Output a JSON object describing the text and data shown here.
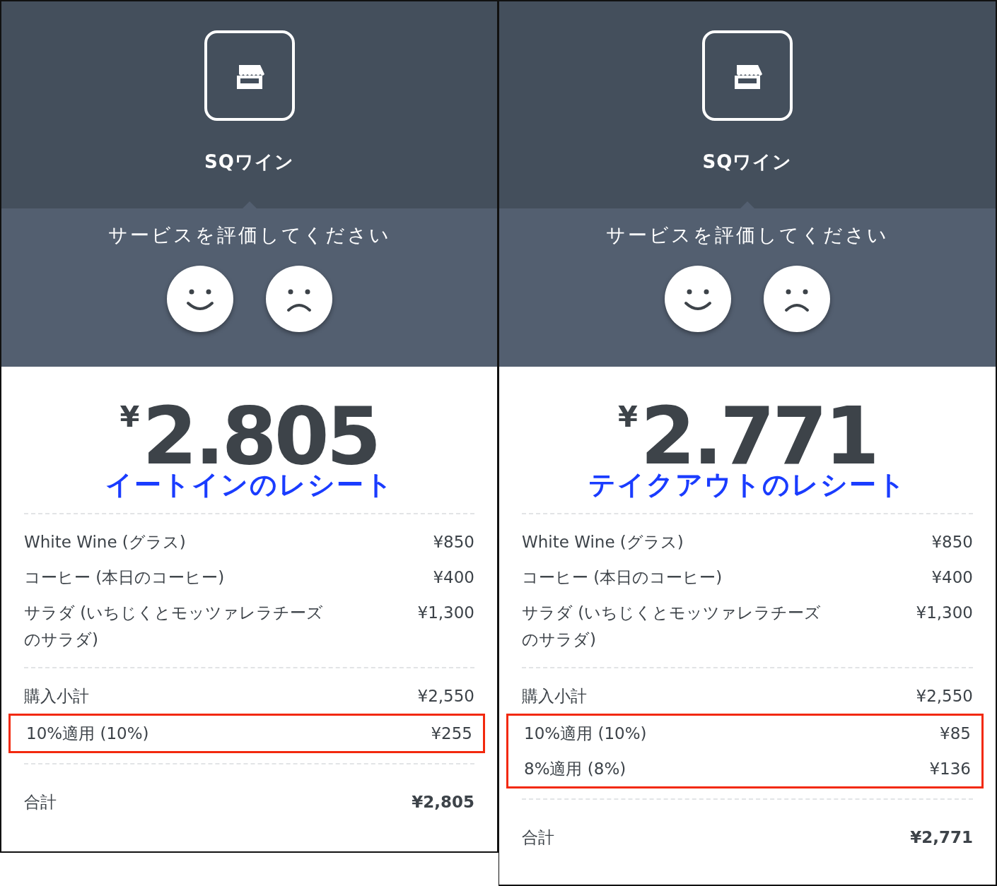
{
  "receipts": [
    {
      "store_name": "SQワイン",
      "rating_prompt": "サービスを評価してください",
      "currency": "¥",
      "amount": "2.805",
      "caption": "イートインのレシート",
      "items": [
        {
          "name": "White Wine (グラス)",
          "price": "¥850"
        },
        {
          "name": "コーヒー (本日のコーヒー)",
          "price": "¥400"
        },
        {
          "name": "サラダ (いちじくとモッツァレラチーズのサラダ)",
          "price": "¥1,300"
        }
      ],
      "subtotal": {
        "label": "購入小計",
        "value": "¥2,550"
      },
      "taxes": {
        "highlighted": true,
        "rows": [
          {
            "label": "10%適用 (10%)",
            "value": "¥255"
          }
        ]
      },
      "total": {
        "label": "合計",
        "value": "¥2,805"
      }
    },
    {
      "store_name": "SQワイン",
      "rating_prompt": "サービスを評価してください",
      "currency": "¥",
      "amount": "2.771",
      "caption": "テイクアウトのレシート",
      "items": [
        {
          "name": "White Wine (グラス)",
          "price": "¥850"
        },
        {
          "name": "コーヒー (本日のコーヒー)",
          "price": "¥400"
        },
        {
          "name": "サラダ (いちじくとモッツァレラチーズのサラダ)",
          "price": "¥1,300"
        }
      ],
      "subtotal": {
        "label": "購入小計",
        "value": "¥2,550"
      },
      "taxes": {
        "highlighted": true,
        "rows": [
          {
            "label": "10%適用 (10%)",
            "value": "¥85"
          },
          {
            "label": "8%適用 (8%)",
            "value": "¥136"
          }
        ]
      },
      "total": {
        "label": "合計",
        "value": "¥2,771"
      }
    }
  ]
}
